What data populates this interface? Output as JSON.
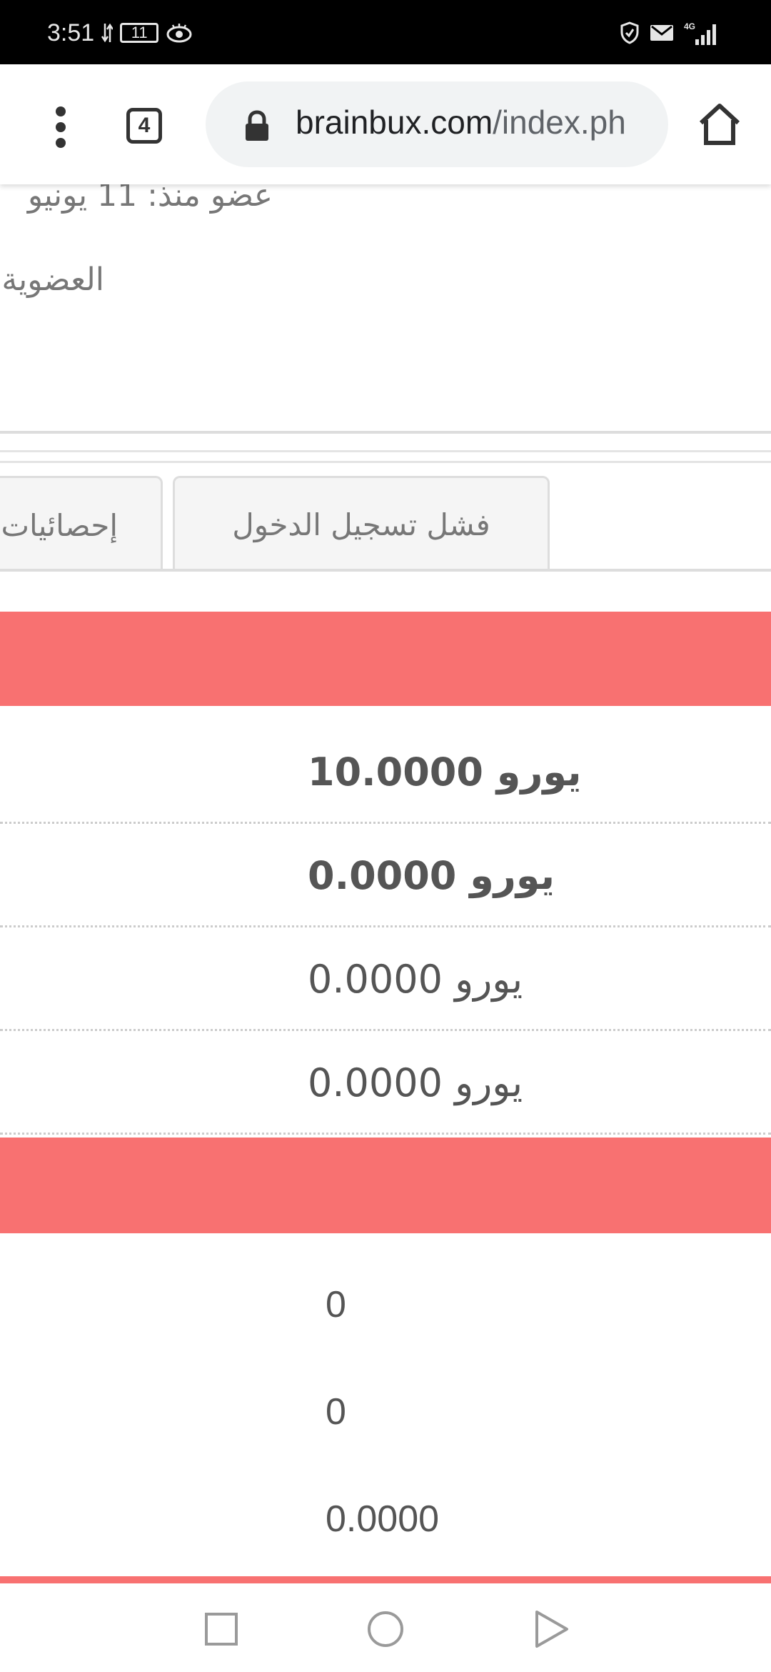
{
  "status_bar": {
    "time": "3:51",
    "battery": "11",
    "network": "4G"
  },
  "browser": {
    "tab_count": "4",
    "url_domain": "brainbux.com",
    "url_path": "/index.ph"
  },
  "profile": {
    "member_since": "عضو منذ: 11 يونيو",
    "membership": "العضوية"
  },
  "tabs": [
    {
      "label": "إحصائيات"
    },
    {
      "label": "فشل تسجيل الدخول"
    }
  ],
  "balances": [
    {
      "value": "يورو 10.0000",
      "bold": true
    },
    {
      "value": "يورو 0.0000",
      "bold": true
    },
    {
      "value": "يورو 0.0000",
      "bold": false
    },
    {
      "value": "يورو 0.0000",
      "bold": false
    }
  ],
  "stats": [
    "0",
    "0",
    "0.0000"
  ],
  "colors": {
    "accent": "#f87171",
    "status_bar": "#000000",
    "url_bar": "#f1f3f4"
  }
}
